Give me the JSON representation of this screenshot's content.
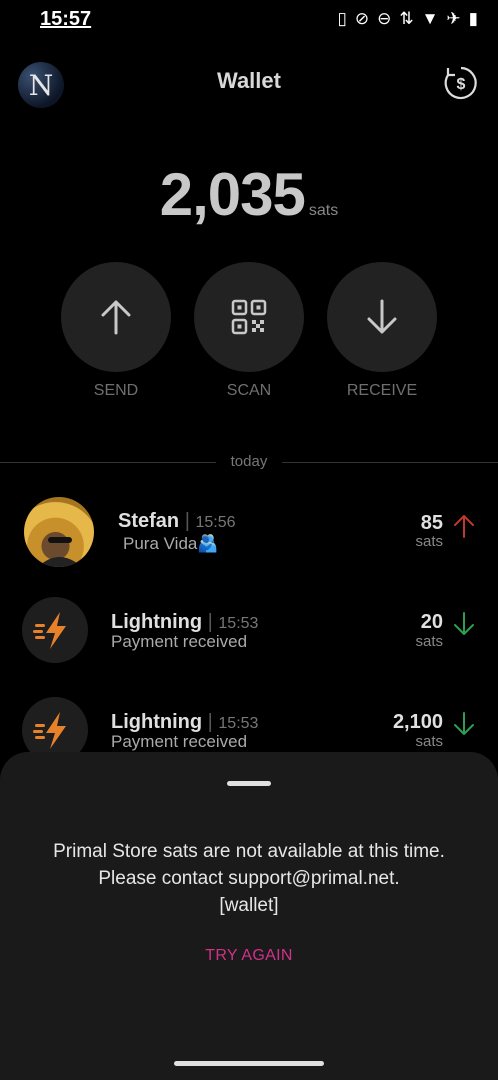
{
  "status_bar": {
    "time": "15:57",
    "icons": [
      "nfc-icon",
      "mute-icon",
      "dnd-icon",
      "data-icon",
      "wifi-icon",
      "airplane-icon",
      "battery-icon"
    ]
  },
  "header": {
    "avatar_letter": "N",
    "title": "Wallet",
    "currency_icon": "dollar-refresh-icon"
  },
  "balance": {
    "value": "2,035",
    "unit": "sats"
  },
  "actions": [
    {
      "label": "SEND",
      "icon": "arrow-up-icon"
    },
    {
      "label": "SCAN",
      "icon": "qr-code-icon"
    },
    {
      "label": "RECEIVE",
      "icon": "arrow-down-icon"
    }
  ],
  "divider_label": "today",
  "transactions": [
    {
      "name": "Stefan",
      "time": "15:56",
      "note": "Pura Vida🫂",
      "amount": "85",
      "unit": "sats",
      "direction": "out",
      "arrow_color": "#c0392b"
    },
    {
      "name": "Lightning",
      "time": "15:53",
      "note": "Payment received",
      "amount": "20",
      "unit": "sats",
      "direction": "in",
      "arrow_color": "#2e9e50"
    },
    {
      "name": "Lightning",
      "time": "15:53",
      "note": "Payment received",
      "amount": "2,100",
      "unit": "sats",
      "direction": "in",
      "arrow_color": "#2e9e50"
    }
  ],
  "sheet": {
    "message": "Primal Store sats are not available at this time. Please contact support@primal.net.",
    "code": "[wallet]",
    "button": "TRY AGAIN"
  },
  "colors": {
    "accent": "#d0318a",
    "lightning": "#e8822a",
    "background": "#000000",
    "sheet": "#1a1a1a"
  }
}
